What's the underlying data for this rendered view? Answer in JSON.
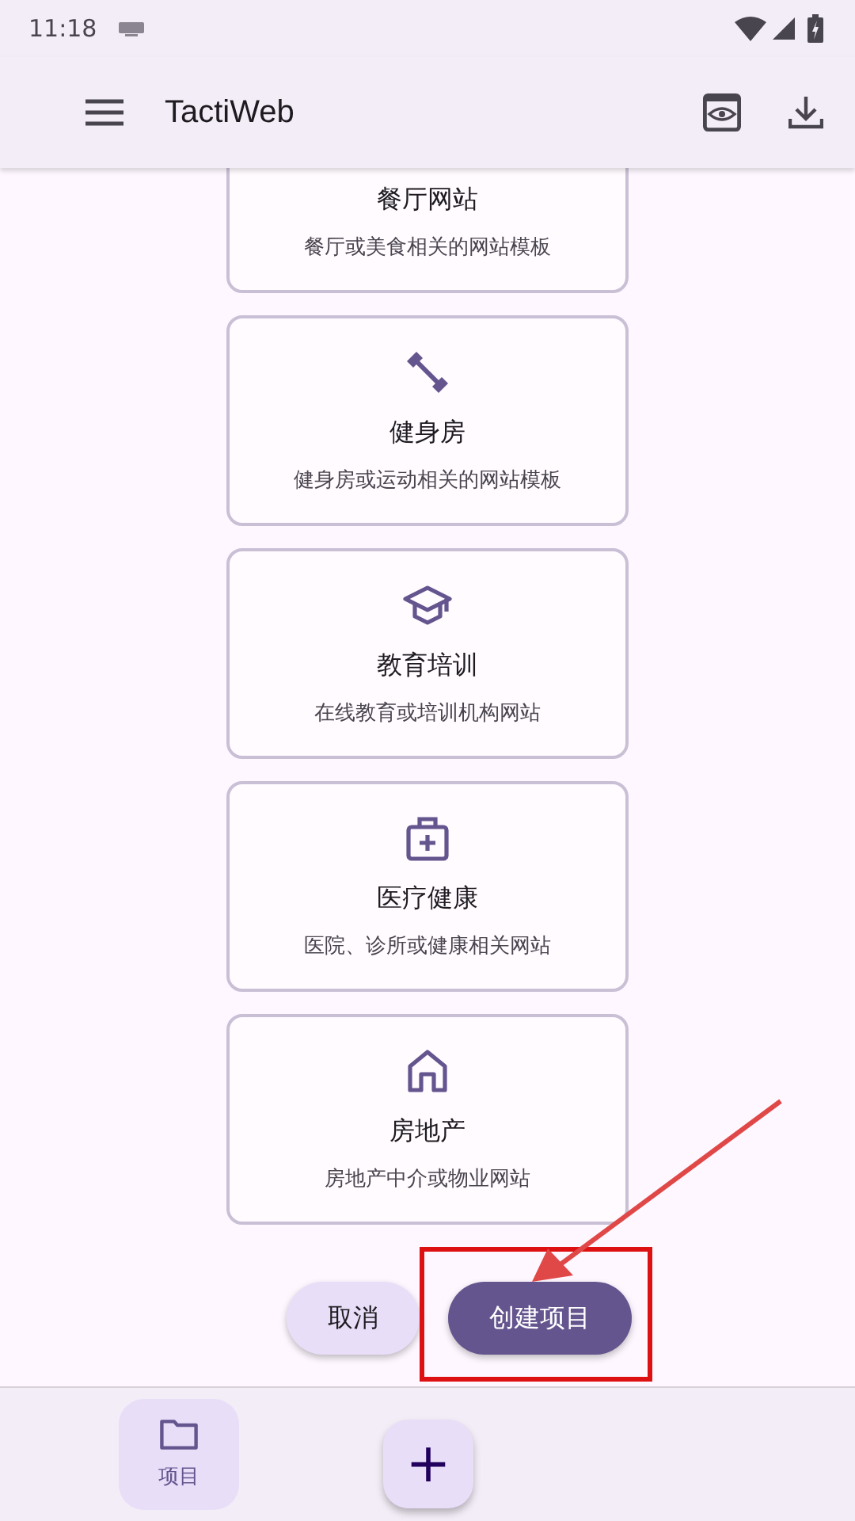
{
  "status_bar": {
    "time": "11:18"
  },
  "app_bar": {
    "title": "TactiWeb"
  },
  "templates": [
    {
      "title": "餐厅网站",
      "description": "餐厅或美食相关的网站模板"
    },
    {
      "kind": "dumbbell",
      "title": "健身房",
      "description": "健身房或运动相关的网站模板"
    },
    {
      "kind": "school",
      "title": "教育培训",
      "description": "在线教育或培训机构网站"
    },
    {
      "kind": "medical",
      "title": "医疗健康",
      "description": "医院、诊所或健康相关网站"
    },
    {
      "kind": "home",
      "title": "房地产",
      "description": "房地产中介或物业网站"
    }
  ],
  "actions": {
    "cancel": "取消",
    "create": "创建项目"
  },
  "bottom_nav": {
    "items": [
      {
        "label": "项目",
        "selected": true
      }
    ],
    "fab": "+"
  }
}
